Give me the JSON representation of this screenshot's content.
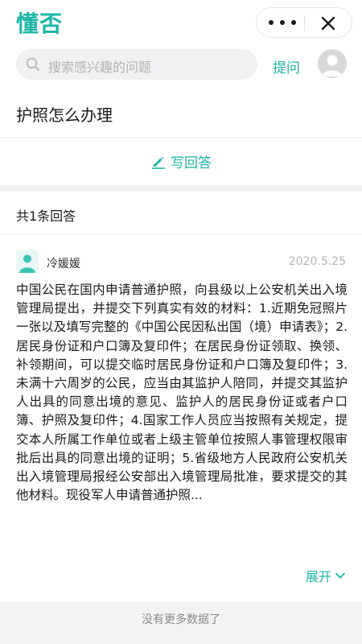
{
  "app": {
    "logo": "懂否"
  },
  "header": {
    "search_placeholder": "搜索感兴趣的问题",
    "ask_label": "提问"
  },
  "question": {
    "title": "护照怎么办理",
    "write_answer_label": "写回答"
  },
  "answers": {
    "count_label": "共1条回答",
    "items": [
      {
        "author": "冷媛媛",
        "date": "2020.5.25",
        "text": "中国公民在国内申请普通护照，向县级以上公安机关出入境管理局提出，并提交下列真实有效的材料：1.近期免冠照片一张以及填写完整的《中国公民因私出国（境）申请表》；2.居民身份证和户口簿及复印件；在居民身份证领取、换领、补领期间，可以提交临时居民身份证和户口簿及复印件；3.未满十六周岁的公民，应当由其监护人陪同，并提交其监护人出具的同意出境的意见、监护人的居民身份证或者户口簿、护照及复印件；4.国家工作人员应当按照有关规定，提交本人所属工作单位或者上级主管单位按照人事管理权限审批后出具的同意出境的证明；5.省级地方人民政府公安机关出入境管理局报经公安部出入境管理局批准，要求提交的其他材料。现役军人申请普通护照...",
        "expand_label": "展开"
      }
    ]
  },
  "footer": {
    "no_more": "没有更多数据了"
  },
  "colors": {
    "accent": "#1bb7a6",
    "background": "#f2f3f4"
  }
}
